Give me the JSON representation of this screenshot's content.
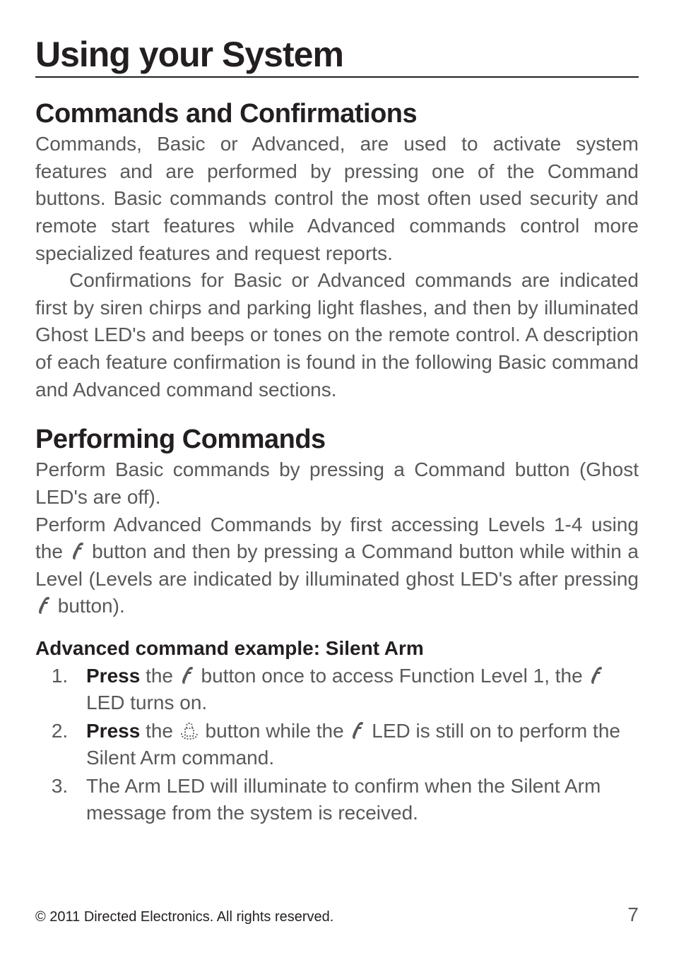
{
  "title": "Using your System",
  "sections": {
    "commands_confirmations": {
      "heading": "Commands and Confirmations",
      "para1": "Commands, Basic or Advanced, are used to activate system features and are performed by pressing one of the Command buttons. Basic commands control the most often used security and remote start features while Advanced commands control more specialized features and request reports.",
      "para2": "Confirmations for Basic or Advanced commands are indicated first by siren chirps and parking light flashes, and then by illuminated Ghost LED's and beeps or tones on the remote control. A description of each feature confirmation is found in the following Basic command and Advanced command sections."
    },
    "performing_commands": {
      "heading": "Performing Commands",
      "para1": "Perform Basic commands by pressing a Command button (Ghost LED's are off).",
      "para2_a": "Perform Advanced Commands by first accessing Levels 1-4 using the ",
      "para2_b": " button and then by pressing a Command button while within a Level (Levels are indicated by illuminated ghost LED's after pressing ",
      "para2_c": " button)."
    },
    "example": {
      "heading": "Advanced command example: Silent Arm",
      "step1_press": "Press",
      "step1_a": " the ",
      "step1_b": " button once to access Function Level 1, the ",
      "step1_c": " LED turns on.",
      "step2_press": "Press",
      "step2_a": " the ",
      "step2_b": " button while the ",
      "step2_c": " LED is still on to perform the Silent Arm command.",
      "step3": "The Arm LED will illuminate to confirm when the Silent Arm message from the system is received."
    }
  },
  "footer": {
    "copyright": "© 2011 Directed Electronics. All rights reserved.",
    "page_number": "7"
  }
}
